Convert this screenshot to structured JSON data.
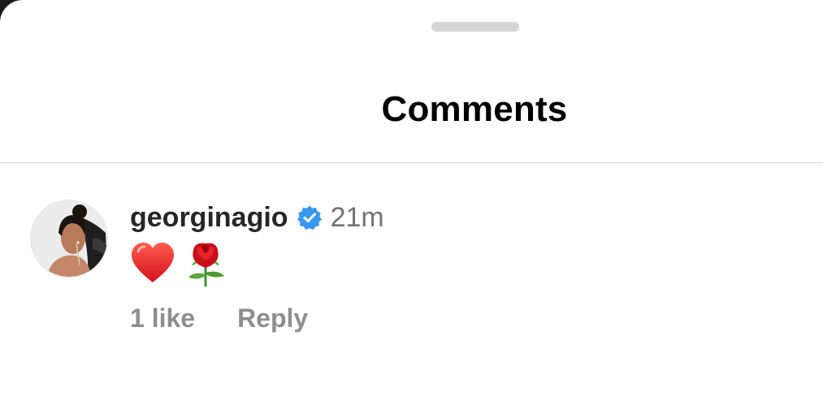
{
  "sheet": {
    "title": "Comments"
  },
  "comment": {
    "username": "georginagio",
    "verified_icon": "verified-badge-icon",
    "time": "21m",
    "emojis": [
      "red-heart-emoji",
      "rose-emoji"
    ],
    "likes_label": "1 like",
    "reply_label": "Reply"
  },
  "colors": {
    "verified": "#3897f0",
    "secondary_text": "#737373",
    "action_text": "#8e8e8e",
    "divider": "#dbdbdb"
  }
}
